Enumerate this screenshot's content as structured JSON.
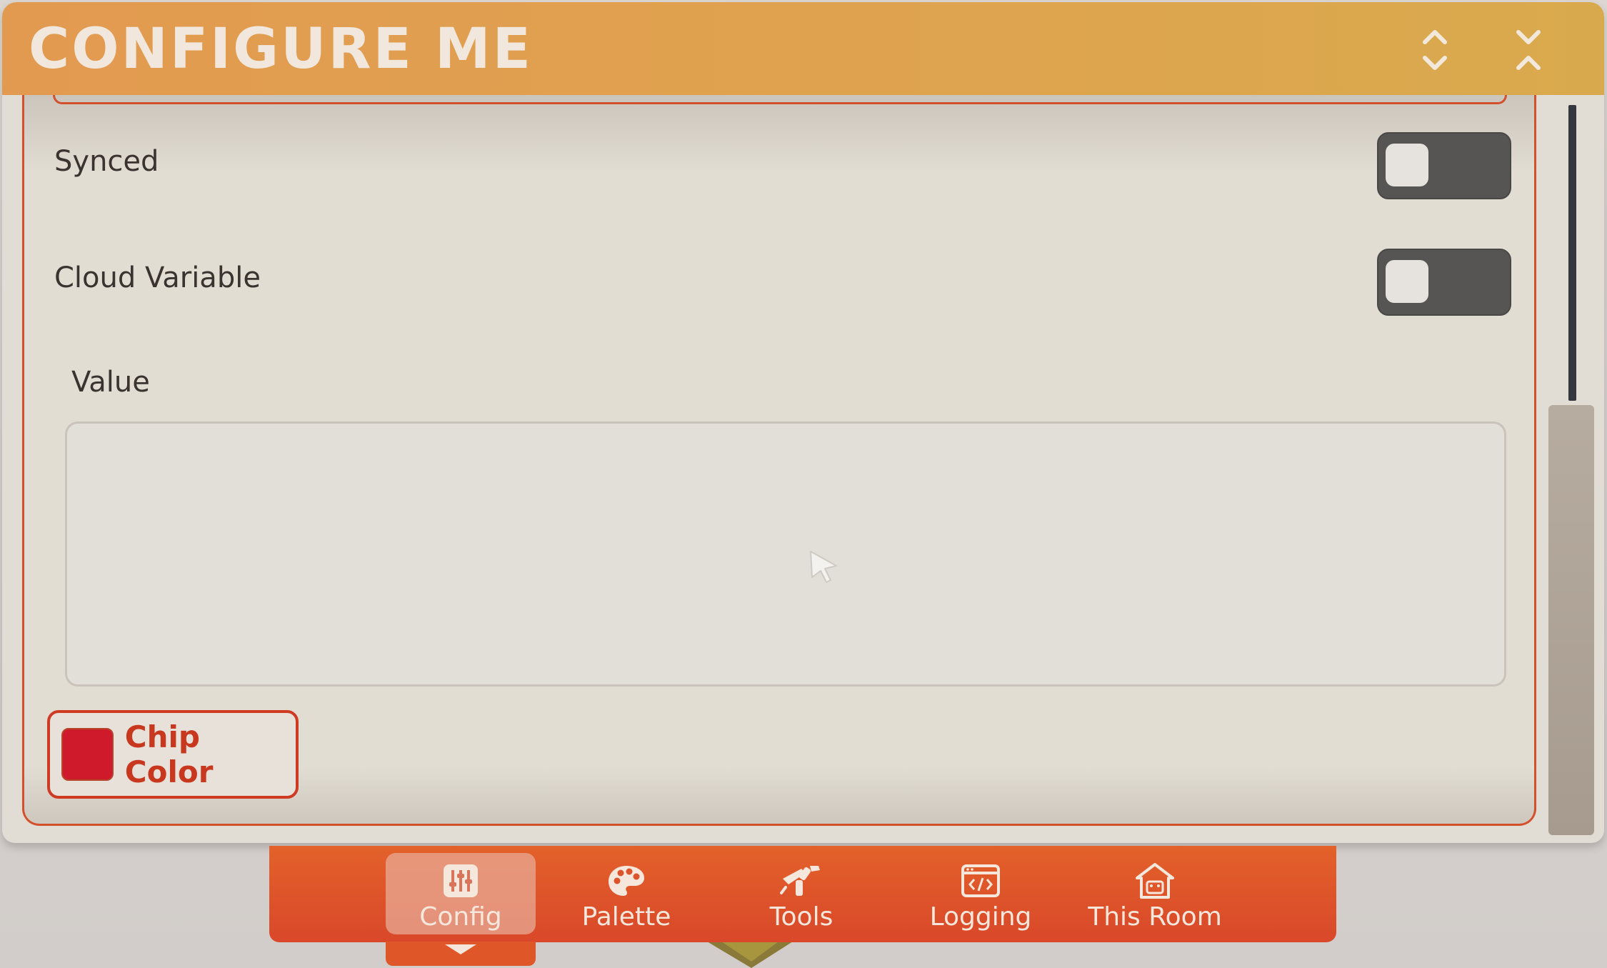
{
  "window": {
    "title": "CONFIGURE ME",
    "expand_icon": "chevron-expand-icon",
    "collapse_icon": "chevron-collapse-icon"
  },
  "settings": {
    "synced": {
      "label": "Synced",
      "on": false
    },
    "cloud_variable": {
      "label": "Cloud Variable",
      "on": false
    },
    "value": {
      "label": "Value",
      "current": ""
    },
    "chip_color": {
      "label": "Chip Color",
      "color": "#cf1a2b"
    }
  },
  "tabs": [
    {
      "label": "Config",
      "icon": "sliders-icon",
      "active": true
    },
    {
      "label": "Palette",
      "icon": "palette-icon",
      "active": false
    },
    {
      "label": "Tools",
      "icon": "tools-icon",
      "active": false
    },
    {
      "label": "Logging",
      "icon": "code-window-icon",
      "active": false
    },
    {
      "label": "This Room",
      "icon": "home-icon",
      "active": false
    }
  ],
  "colors": {
    "title_bar": "#e29a50",
    "accent": "#d2502c",
    "tab_bar": "#e3612a",
    "toggle_off": "#575553"
  }
}
